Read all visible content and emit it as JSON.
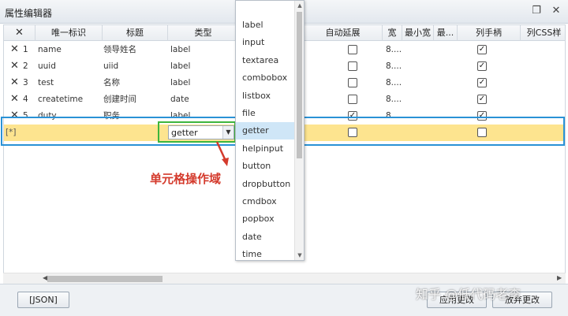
{
  "window": {
    "title": "属性编辑器"
  },
  "grid": {
    "columns": [
      {
        "label": ""
      },
      {
        "label": "唯一标识"
      },
      {
        "label": "标题"
      },
      {
        "label": "类型"
      },
      {
        "label": "认值"
      },
      {
        "label": "自动延展"
      },
      {
        "label": "宽"
      },
      {
        "label": "最小宽"
      },
      {
        "label": "最..."
      },
      {
        "label": "列手柄"
      },
      {
        "label": "列CSS样"
      }
    ],
    "rows": [
      {
        "num": "1",
        "id": "name",
        "title": "领导姓名",
        "type": "label",
        "width": "8....",
        "autostretch": false,
        "handle": true
      },
      {
        "num": "2",
        "id": "uuid",
        "title": "uiid",
        "type": "label",
        "width": "8....",
        "autostretch": false,
        "handle": true
      },
      {
        "num": "3",
        "id": "test",
        "title": "名称",
        "type": "label",
        "width": "8....",
        "autostretch": false,
        "handle": true
      },
      {
        "num": "4",
        "id": "createtime",
        "title": "创建时间",
        "type": "date",
        "width": "8....",
        "autostretch": false,
        "handle": true
      },
      {
        "num": "5",
        "id": "duty",
        "title": "职务",
        "type": "label",
        "width": "8....",
        "autostretch": true,
        "handle": true
      }
    ],
    "new_row": {
      "marker": "[*]",
      "type_value": "getter",
      "autostretch": false,
      "handle": false
    }
  },
  "dropdown": {
    "items": [
      "label",
      "input",
      "textarea",
      "combobox",
      "listbox",
      "file",
      "getter",
      "helpinput",
      "button",
      "dropbutton",
      "cmdbox",
      "popbox",
      "date",
      "time"
    ],
    "selected": "getter"
  },
  "annotation": {
    "text": "单元格操作域"
  },
  "footer": {
    "json_button": "[JSON]",
    "apply_button": "应用更改",
    "cancel_button": "放弃更改"
  },
  "watermark": {
    "text": "知乎 @低代码老李"
  },
  "colors": {
    "selection_border": "#2a92d6",
    "edit_border": "#3db53d",
    "new_row_bg": "#fde48f",
    "annotation": "#d43a2c"
  }
}
